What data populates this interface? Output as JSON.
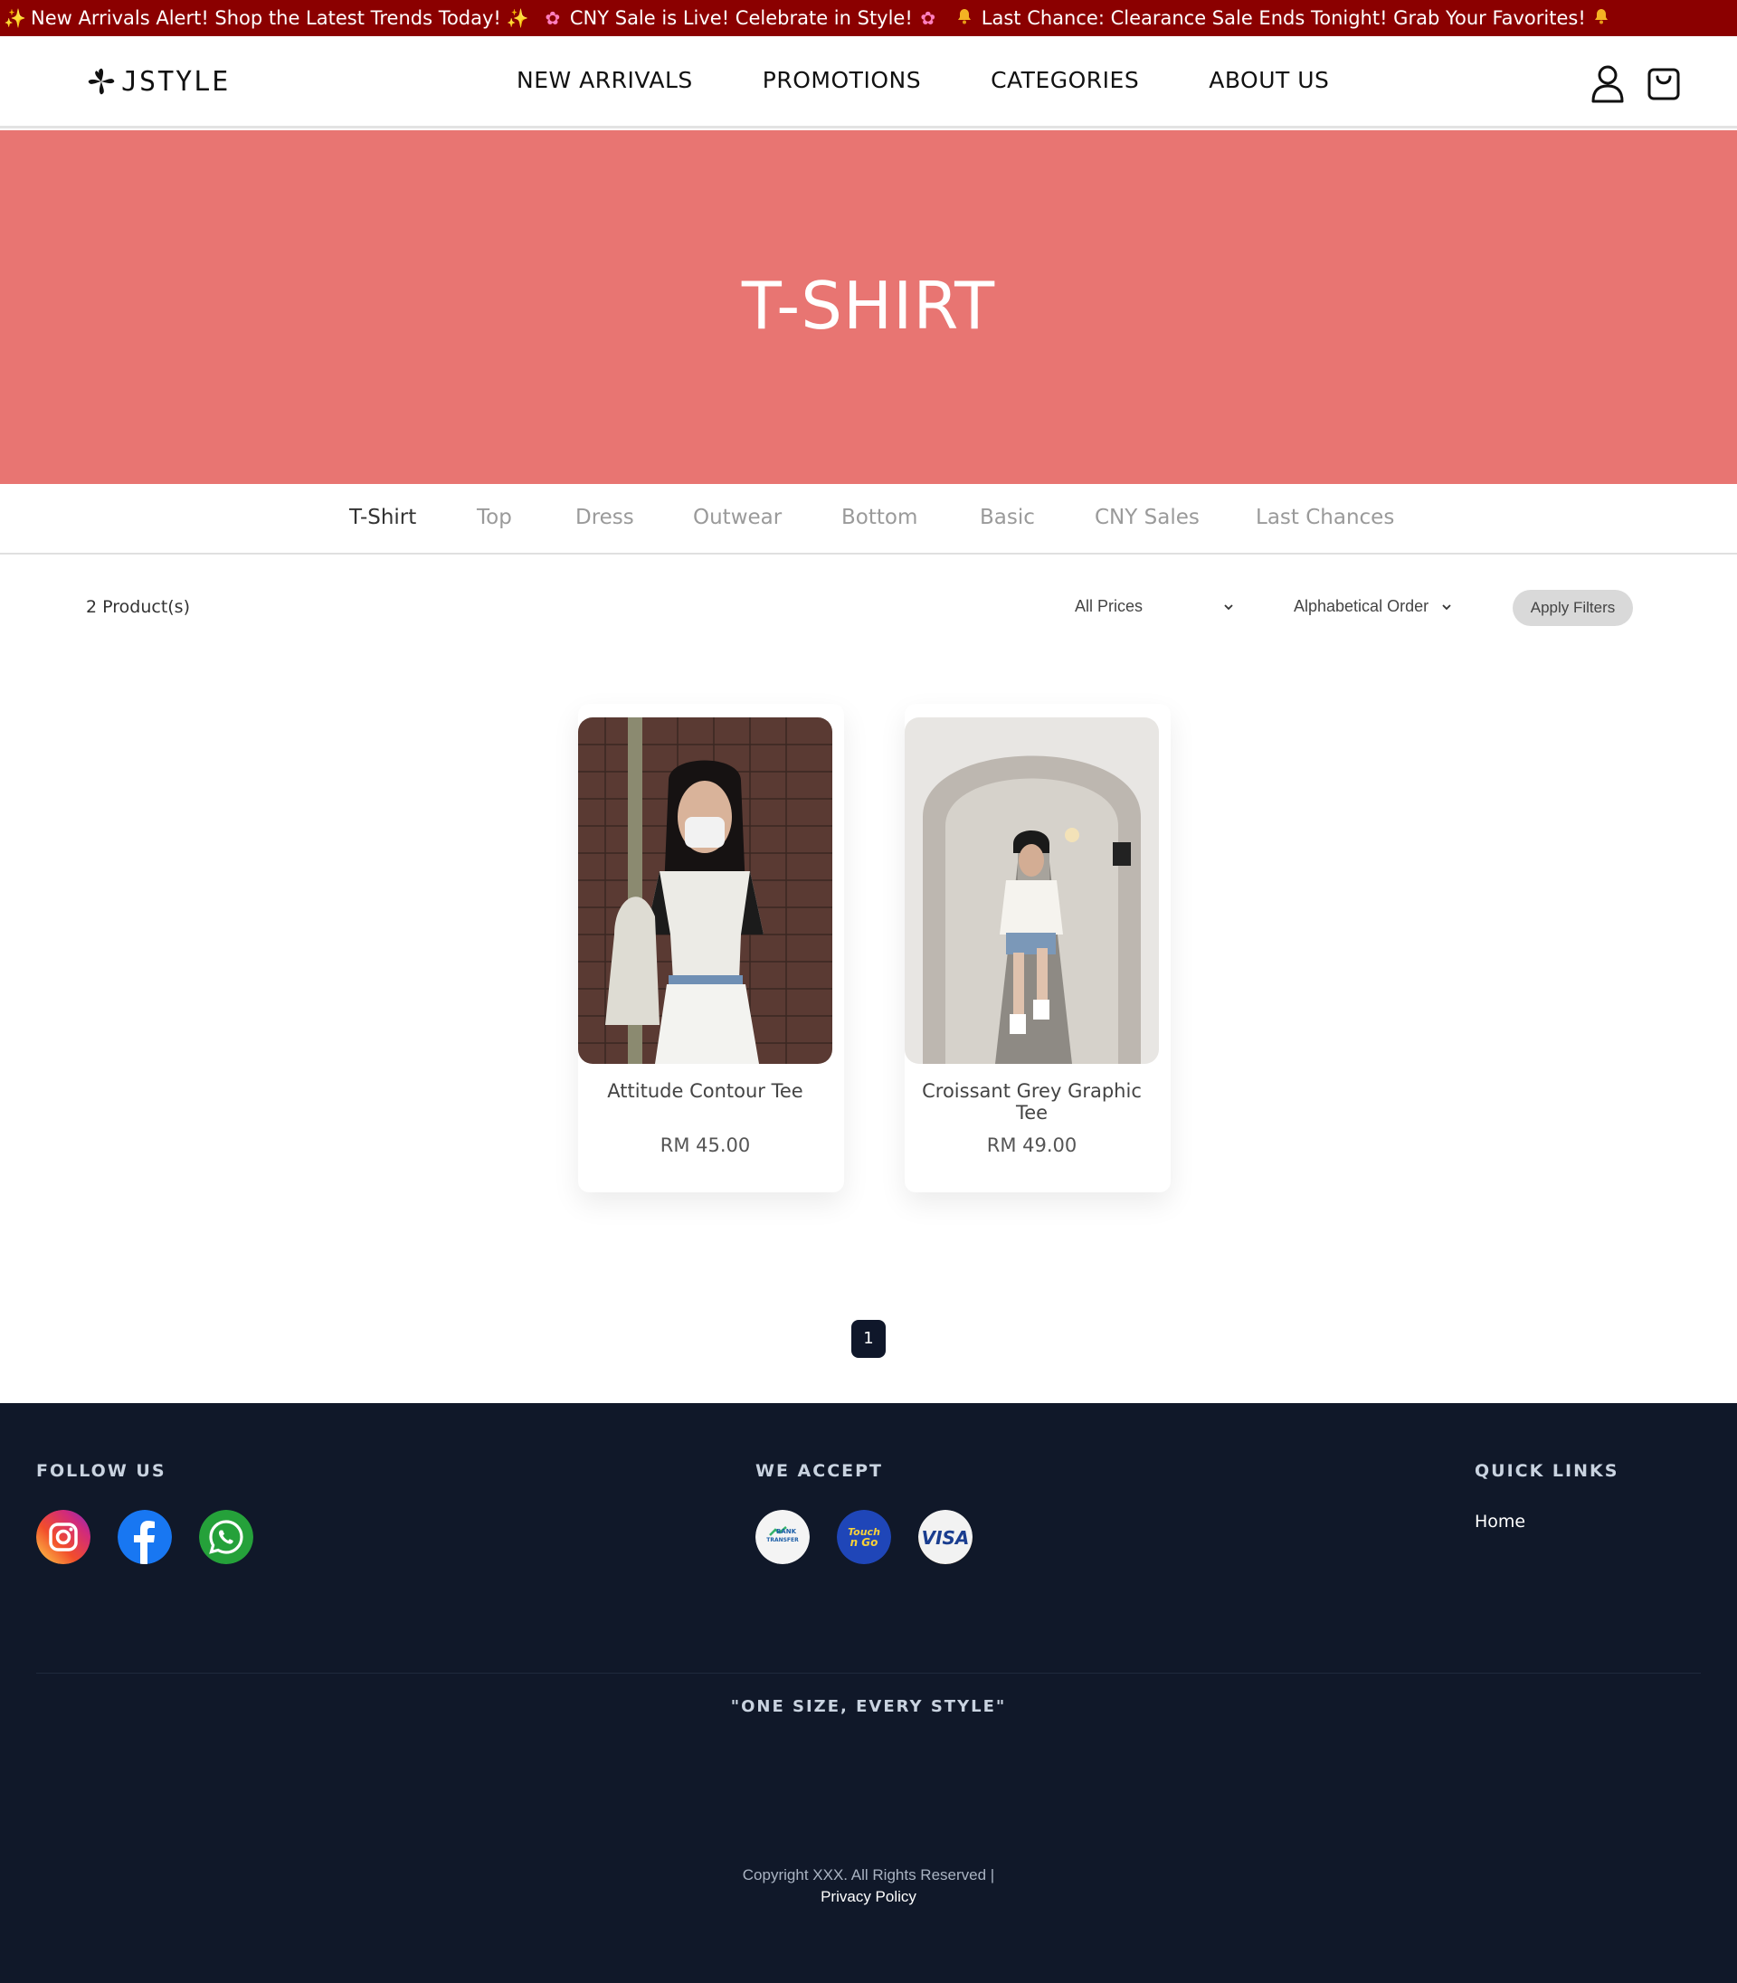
{
  "announcement": {
    "messages": [
      {
        "icon": "sparkles-icon",
        "glyph": "✨",
        "text": "New Arrivals Alert! Shop the Latest Trends Today!",
        "trail_icon": "sparkles-icon",
        "trail_glyph": "✨"
      },
      {
        "icon": "flower-icon",
        "glyph": "✿",
        "text": "CNY Sale is Live! Celebrate in Style!",
        "trail_icon": "flower-icon",
        "trail_glyph": "✿"
      },
      {
        "icon": "bell-icon",
        "glyph": "🔔",
        "text": "Last Chance: Clearance Sale Ends Tonight! Grab Your Favorites!",
        "trail_icon": "bell-icon",
        "trail_glyph": "🔔"
      }
    ],
    "bg_color": "#8b0000"
  },
  "header": {
    "logo_text": "JSTYLE",
    "nav": [
      "NEW ARRIVALS",
      "PROMOTIONS",
      "CATEGORIES",
      "ABOUT US"
    ],
    "icons": [
      "user-icon",
      "shopping-bag-icon"
    ]
  },
  "hero": {
    "title": "T-SHIRT",
    "bg_color": "#e87572"
  },
  "subcategories": {
    "items": [
      "T-Shirt",
      "Top",
      "Dress",
      "Outwear",
      "Bottom",
      "Basic",
      "CNY Sales",
      "Last Chances"
    ],
    "active": "T-Shirt"
  },
  "toolbar": {
    "count": "2 Product(s)",
    "price_filter": "All Prices",
    "sort": "Alphabetical Order",
    "apply_label": "Apply Filters"
  },
  "products": [
    {
      "name": "Attitude Contour Tee",
      "price": "RM 45.00"
    },
    {
      "name": "Croissant Grey Graphic Tee",
      "price": "RM 49.00"
    }
  ],
  "pagination": {
    "current": "1"
  },
  "footer": {
    "follow_heading": "FOLLOW US",
    "social": [
      "instagram-icon",
      "facebook-icon",
      "whatsapp-icon"
    ],
    "accept_heading": "WE ACCEPT",
    "payments": [
      "bank-transfer-icon",
      "touch-n-go-icon",
      "visa-icon"
    ],
    "payment_labels": {
      "bank": "BANK TRANSFER",
      "tng": "Touch n Go",
      "visa": "VISA"
    },
    "quick_heading": "QUICK LINKS",
    "quick_links": [
      "Home"
    ],
    "slogan": "\"ONE SIZE, EVERY STYLE\"",
    "copyright": "Copyright XXX. All Rights Reserved |",
    "policy": "Privacy Policy",
    "bg_color": "#101829"
  }
}
